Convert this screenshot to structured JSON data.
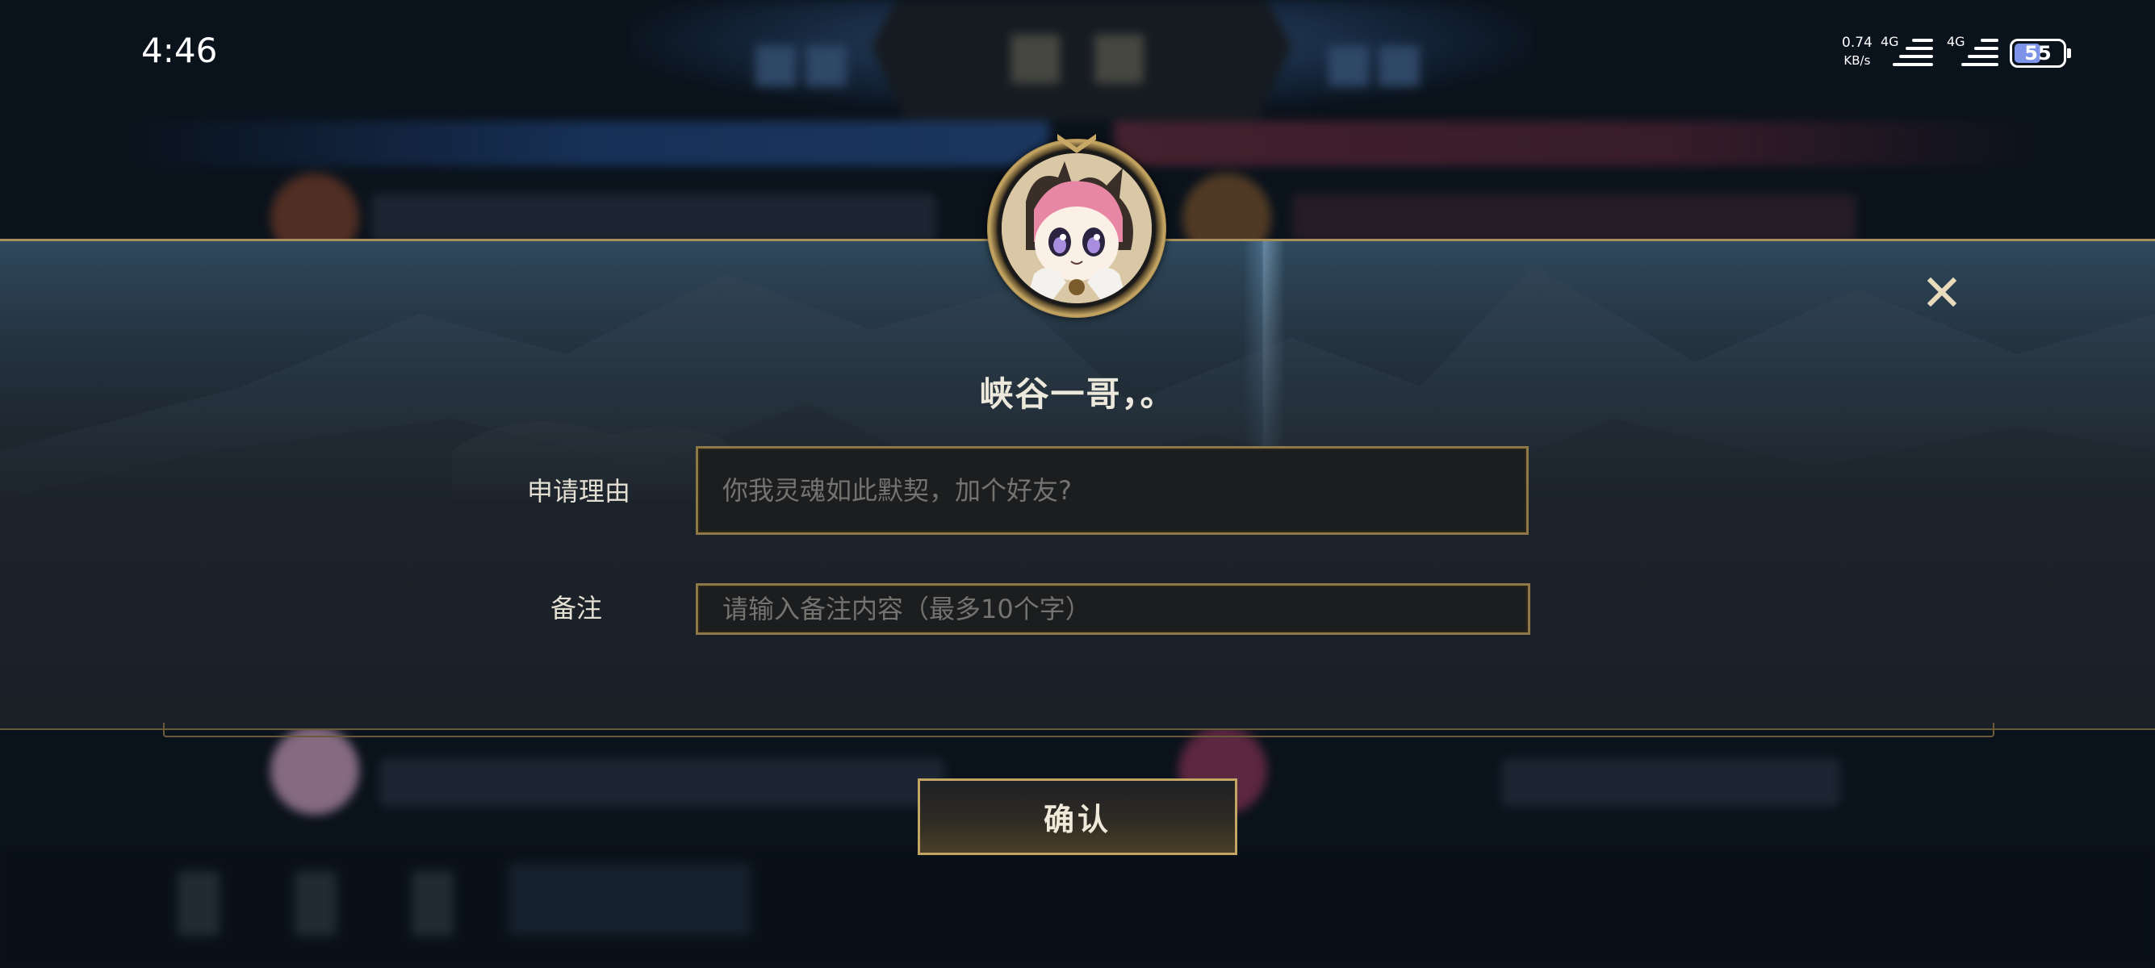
{
  "status_bar": {
    "time": "4:46",
    "net_speed_value": "0.74",
    "net_speed_unit": "KB/s",
    "net_type_1": "4G",
    "net_type_2": "4G",
    "battery_level": "55",
    "battery_fraction": 0.55
  },
  "dialog": {
    "title": "峡谷一哥，。",
    "reason_label": "申请理由",
    "reason_placeholder": "你我灵魂如此默契，加个好友?",
    "note_label": "备注",
    "note_placeholder": "请输入备注内容（最多10个字）",
    "close_symbol": "✕",
    "confirm_label": "确认"
  },
  "colors": {
    "accent_gold": "#c4a664",
    "panel_bg": "#1c232b",
    "battery_blue": "#7d93e8"
  },
  "icons": [
    "close-icon",
    "avatar-portrait",
    "signal-icon",
    "battery-icon"
  ]
}
